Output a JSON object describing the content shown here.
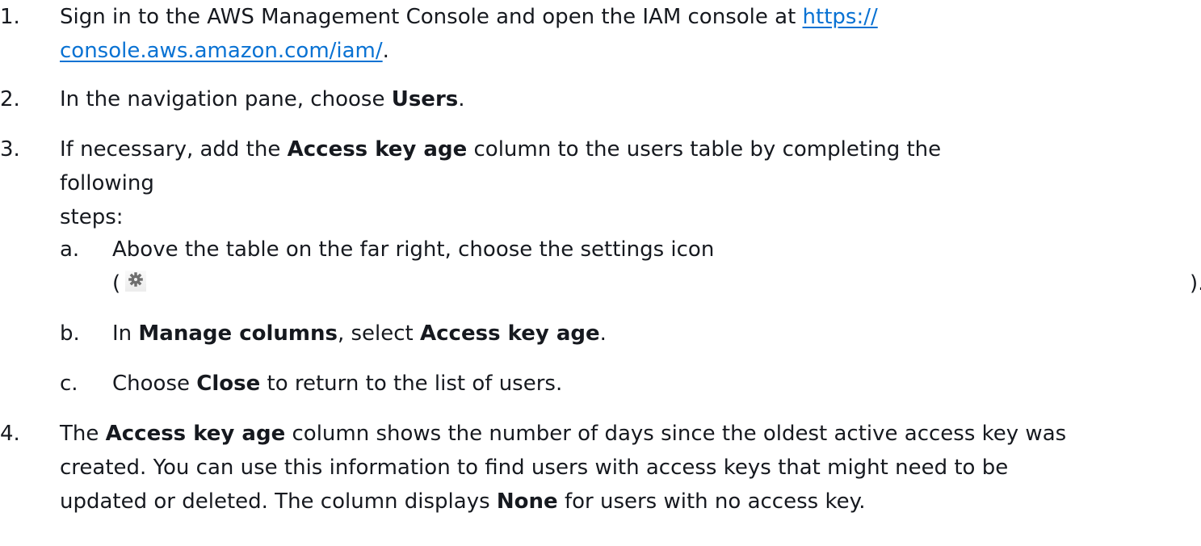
{
  "steps": [
    {
      "number": "1.",
      "text_before": "Sign in to the AWS Management Console and open the IAM console at ",
      "link_line1": "https://",
      "link_line2": "console.aws.amazon.com/iam/",
      "text_after": "."
    },
    {
      "number": "2.",
      "text_before": "In the navigation pane, choose ",
      "bold": "Users",
      "text_after": "."
    },
    {
      "number": "3.",
      "text_before": "If necessary, add the ",
      "bold": "Access key age",
      "text_after_line1": " column to the users table by completing the following",
      "text_after_line2": "steps:",
      "substeps": [
        {
          "letter": "a.",
          "text": "Above the table on the far right, choose the settings icon",
          "paren_open": "(",
          "icon": "gear-icon",
          "paren_close": ")."
        },
        {
          "letter": "b.",
          "text1": "In ",
          "bold1": "Manage columns",
          "text2": ", select ",
          "bold2": "Access key age",
          "text3": "."
        },
        {
          "letter": "c.",
          "text1": "Choose ",
          "bold1": "Close",
          "text2": " to return to the list of users."
        }
      ]
    },
    {
      "number": "4.",
      "text1": "The ",
      "bold1": "Access key age",
      "text2_line1": " column shows the number of days since the oldest active access key was",
      "text2_line2": "created. You can use this information to find users with access keys that might need to be",
      "text2_line3": "updated or deleted. The column displays ",
      "bold2": "None",
      "text3": " for users with no access key."
    }
  ]
}
